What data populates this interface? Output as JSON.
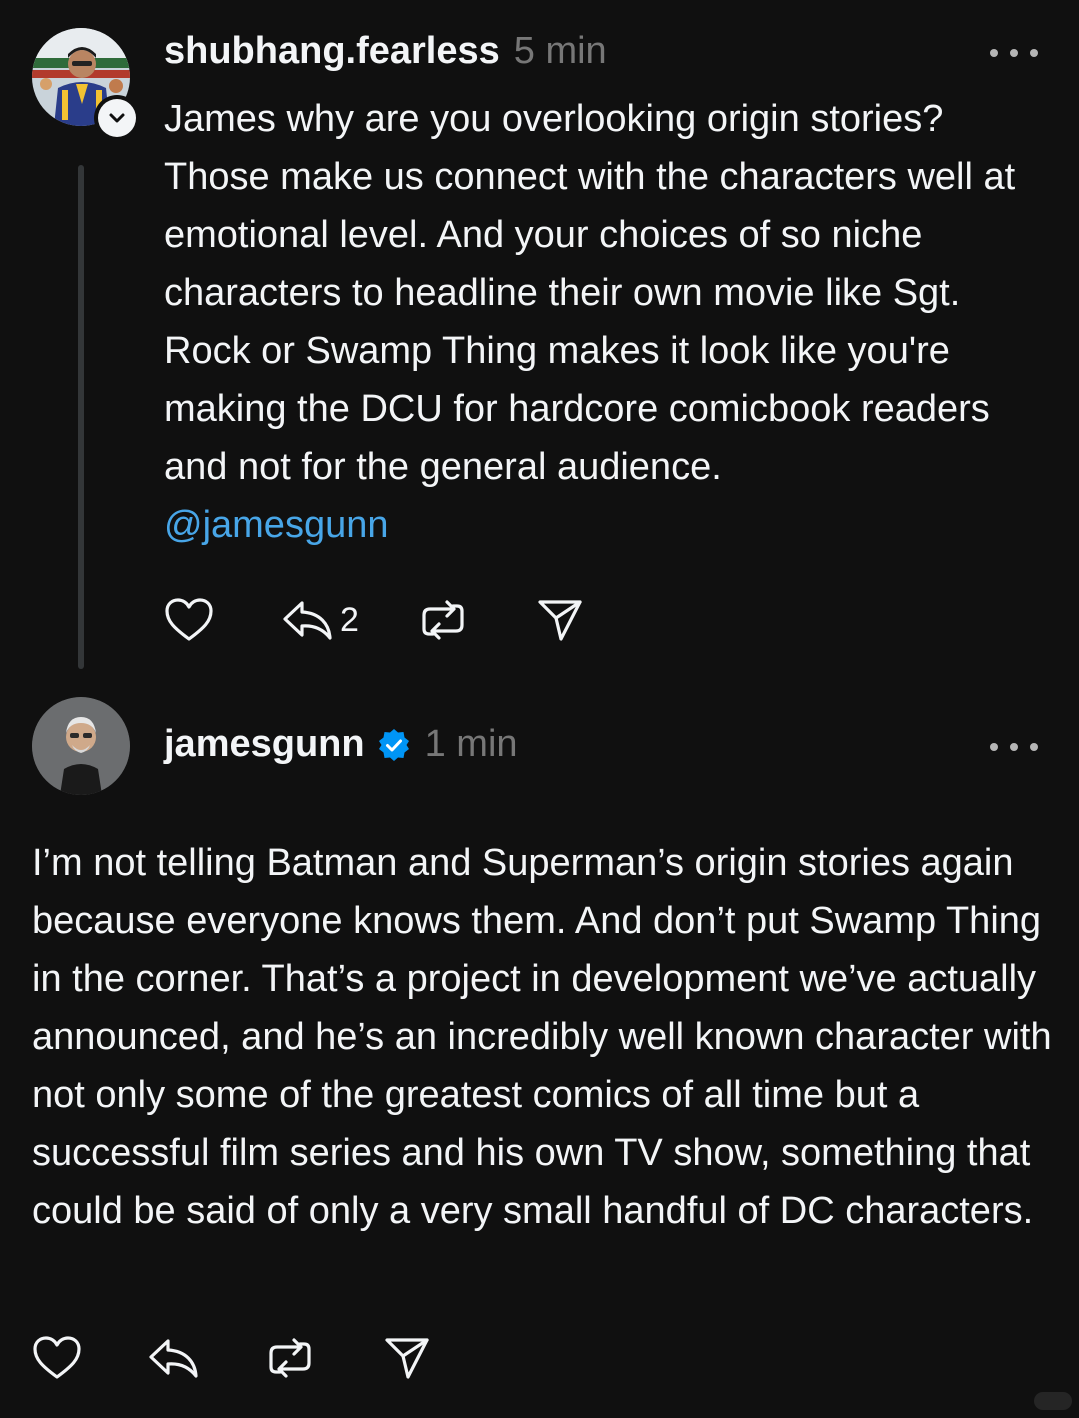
{
  "posts": [
    {
      "username": "shubhang.fearless",
      "time": "5 min",
      "text": "James why are you overlooking origin stories? Those make us connect with the characters well at emotional level. And your choices of so niche characters to headline their own movie like Sgt. Rock or Swamp Thing makes it look like you're making the DCU for hardcore comicbook readers and not for the general audience.",
      "mention": "@jamesgunn",
      "reply_count": "2",
      "has_follow_badge": true,
      "verified": false
    },
    {
      "username": "jamesgunn",
      "time": "1 min",
      "text": "I’m not telling Batman and Superman’s origin stories again because everyone knows them. And don’t put Swamp Thing in the corner. That’s a project in development we’ve actually announced, and he’s an incredibly well known character with not only some of the greatest comics of all time but a successful film series and his own TV show, something that could be said of only a very small handful of DC characters.",
      "verified": true
    }
  ],
  "colors": {
    "background": "#101010",
    "text": "#f3f5f7",
    "muted": "#777777",
    "mention": "#48a6e8",
    "verified": "#0095f6",
    "thread_line": "#333638"
  }
}
